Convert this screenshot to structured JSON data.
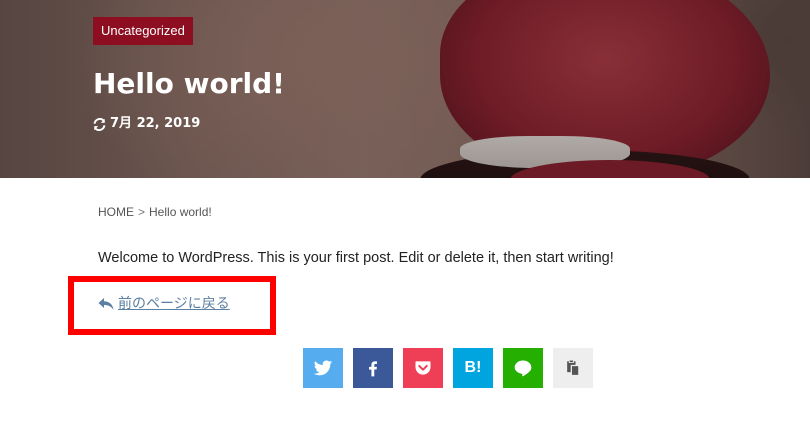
{
  "header": {
    "category": "Uncategorized",
    "title": "Hello world!",
    "date": "7月 22, 2019"
  },
  "breadcrumb": {
    "home": "HOME",
    "separator": ">",
    "current": "Hello world!"
  },
  "content": {
    "text": "Welcome to WordPress. This is your first post. Edit or delete it, then start writing!"
  },
  "back_link": {
    "label": "前のページに戻る"
  },
  "share_buttons": [
    {
      "name": "twitter",
      "icon": "twitter-icon",
      "color": "#55acee"
    },
    {
      "name": "facebook",
      "icon": "facebook-icon",
      "color": "#3b5998"
    },
    {
      "name": "pocket",
      "icon": "pocket-icon",
      "color": "#ef3f56"
    },
    {
      "name": "hatena",
      "icon": "hatena-bookmark-icon",
      "label": "B!",
      "color": "#00a4de"
    },
    {
      "name": "line",
      "icon": "line-icon",
      "color": "#25af00"
    },
    {
      "name": "copy",
      "icon": "copy-icon",
      "color": "#eeeeee"
    }
  ],
  "colors": {
    "category_badge": "#8c0e20",
    "link": "#5b7fa3",
    "highlight": "#ff0000"
  }
}
